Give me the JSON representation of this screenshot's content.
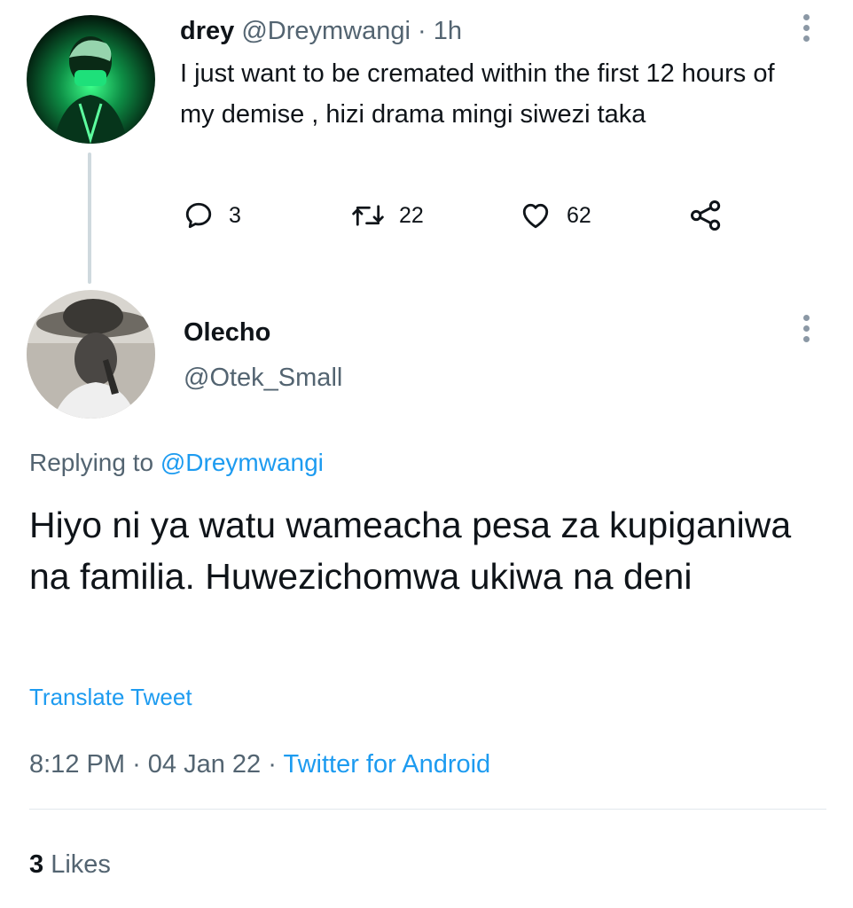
{
  "parent_tweet": {
    "display_name": "drey",
    "handle": "@Dreymwangi",
    "separator": "·",
    "time": "1h",
    "text": "I just want to be cremated within the first 12 hours of my demise , hizi drama mingi siwezi taka",
    "actions": {
      "replies": "3",
      "retweets": "22",
      "likes": "62"
    }
  },
  "reply_tweet": {
    "display_name": "Olecho",
    "handle": "@Otek_Small",
    "replying_prefix": "Replying to",
    "replying_to": "@Dreymwangi",
    "text": "Hiyo ni ya watu wameacha pesa za kupiganiwa na familia. Huwezichomwa ukiwa na deni",
    "translate_label": "Translate Tweet",
    "time": "8:12 PM",
    "date": "04 Jan 22",
    "source": "Twitter for Android",
    "likes_count": "3",
    "likes_label": "Likes"
  },
  "icons": {
    "reply": "reply-icon",
    "retweet": "retweet-icon",
    "like": "heart-icon",
    "share": "share-icon",
    "more": "more-vertical-icon"
  },
  "colors": {
    "link": "#1d9bf0",
    "secondary_text": "#536471",
    "primary_text": "#0f1419"
  }
}
